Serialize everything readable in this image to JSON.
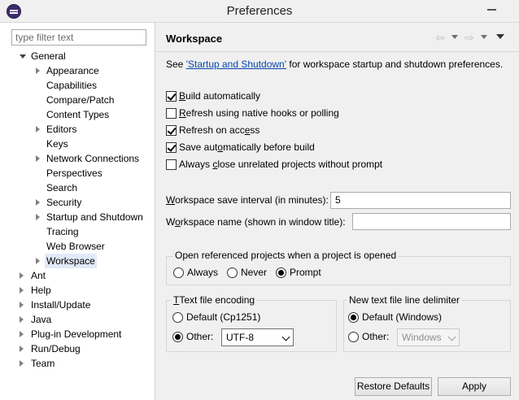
{
  "window": {
    "title": "Preferences"
  },
  "sidebar": {
    "filter_placeholder": "type filter text",
    "tree": [
      {
        "label": "General",
        "level": 0,
        "state": "expanded"
      },
      {
        "label": "Appearance",
        "level": 1,
        "state": "collapsed"
      },
      {
        "label": "Capabilities",
        "level": 1,
        "state": "leaf"
      },
      {
        "label": "Compare/Patch",
        "level": 1,
        "state": "leaf"
      },
      {
        "label": "Content Types",
        "level": 1,
        "state": "leaf"
      },
      {
        "label": "Editors",
        "level": 1,
        "state": "collapsed"
      },
      {
        "label": "Keys",
        "level": 1,
        "state": "leaf"
      },
      {
        "label": "Network Connections",
        "level": 1,
        "state": "collapsed"
      },
      {
        "label": "Perspectives",
        "level": 1,
        "state": "leaf"
      },
      {
        "label": "Search",
        "level": 1,
        "state": "leaf"
      },
      {
        "label": "Security",
        "level": 1,
        "state": "collapsed"
      },
      {
        "label": "Startup and Shutdown",
        "level": 1,
        "state": "collapsed"
      },
      {
        "label": "Tracing",
        "level": 1,
        "state": "leaf"
      },
      {
        "label": "Web Browser",
        "level": 1,
        "state": "leaf"
      },
      {
        "label": "Workspace",
        "level": 1,
        "state": "collapsed",
        "selected": true
      },
      {
        "label": "Ant",
        "level": 0,
        "state": "collapsed"
      },
      {
        "label": "Help",
        "level": 0,
        "state": "collapsed"
      },
      {
        "label": "Install/Update",
        "level": 0,
        "state": "collapsed"
      },
      {
        "label": "Java",
        "level": 0,
        "state": "collapsed"
      },
      {
        "label": "Plug-in Development",
        "level": 0,
        "state": "collapsed"
      },
      {
        "label": "Run/Debug",
        "level": 0,
        "state": "collapsed"
      },
      {
        "label": "Team",
        "level": 0,
        "state": "collapsed"
      }
    ]
  },
  "icons": {
    "app": "eclipse-icon",
    "minimize": "minimize-icon",
    "back": "back-arrow-icon",
    "forward": "forward-arrow-icon",
    "view_menu": "view-menu-icon"
  },
  "colors": {
    "selection": "#e1eaf7",
    "link": "#0645ad",
    "app_icon": "#3c2b6b"
  },
  "page": {
    "title": "Workspace",
    "intro_prefix": "See ",
    "intro_link": "'Startup and Shutdown'",
    "intro_suffix": " for workspace startup and shutdown preferences.",
    "options": [
      {
        "label": "Build automatically",
        "mnemonic_index": 0,
        "checked": true
      },
      {
        "label": "Refresh using native hooks or polling",
        "mnemonic_index": 0,
        "checked": false
      },
      {
        "label": "Refresh on access",
        "mnemonic_index": 14,
        "checked": true
      },
      {
        "label": "Save automatically before build",
        "mnemonic_index": 8,
        "checked": true
      },
      {
        "label": "Always close unrelated projects without prompt",
        "mnemonic_index": 7,
        "checked": false
      }
    ],
    "save_interval_label": "Workspace save interval (in minutes):",
    "save_interval_value": "5",
    "name_label": "Workspace name (shown in window title):",
    "name_value": "",
    "open_projects": {
      "label": "Open referenced projects when a project is opened",
      "choices": [
        "Always",
        "Never",
        "Prompt"
      ],
      "selected": "Prompt"
    },
    "encoding": {
      "label": "Text file encoding",
      "default_label": "Default (Cp1251)",
      "other_label": "Other:",
      "other_value": "UTF-8",
      "selected": "Other"
    },
    "delimiter": {
      "label": "New text file line delimiter",
      "default_label": "Default (Windows)",
      "other_label": "Other:",
      "other_value": "Windows",
      "selected": "Default"
    },
    "restore_defaults_label": "Restore Defaults",
    "apply_label": "Apply"
  }
}
